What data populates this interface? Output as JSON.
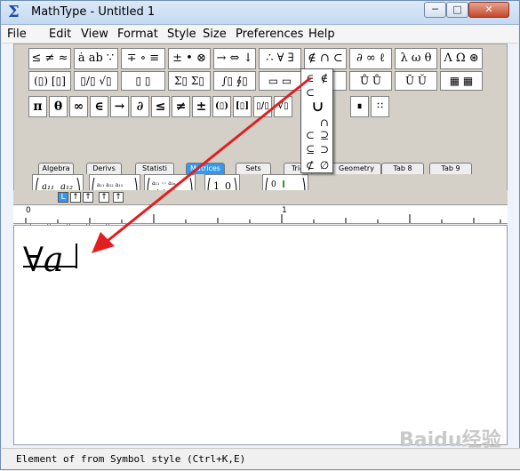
{
  "window": {
    "title": "MathType - Untitled 1",
    "app_icon": "Σ"
  },
  "window_controls": {
    "minimize": "─",
    "maximize": "□",
    "close": "✕"
  },
  "menu": [
    "File",
    "Edit",
    "View",
    "Format",
    "Style",
    "Size",
    "Preferences",
    "Help"
  ],
  "palettes_row1": [
    "≤ ≠ ≈",
    "ȧ ab ∵",
    "∓ ∘ ≡",
    "± • ⊗",
    "→ ⇔ ↓",
    "∴ ∀ ∃",
    "∉ ∩ ⊂",
    "∂ ∞ ℓ",
    "λ ω θ",
    "Λ Ω ⊛"
  ],
  "palettes_row2": [
    "(▯) [▯]",
    "▯/▯ √▯",
    "▯ ▯",
    "Σ▯ Σ▯",
    "∫▯ ∮▯",
    "▭ ▭",
    "",
    "Ů Ů",
    "Ū Ǔ",
    "▦ ▦",
    "▯ ▯"
  ],
  "symbols": [
    "π",
    "θ",
    "∞",
    "∈",
    "→",
    "∂",
    "≤",
    "≠",
    "±",
    "(▯)",
    "[▯]",
    "▯/▯",
    "√▯",
    "∎",
    "∷"
  ],
  "tabs": [
    "Algebra",
    "Derivs",
    "Statisti",
    "Matrices",
    "Sets",
    "Trig",
    "Geometry",
    "Tab 8",
    "Tab 9"
  ],
  "active_tab": "Matrices",
  "templates": [
    "(a11 a12; a21 a22)",
    "3x3 matrix",
    "m x n matrix",
    "(1 0; 0 1)",
    "dotted matrix"
  ],
  "matrix_buttons": [
    "...",
    "⋯",
    "⋮",
    "⋰",
    "⋱"
  ],
  "dropdown_items": [
    "∈",
    "∉",
    "⊂",
    "∪",
    "∩",
    "⊂",
    "⊃",
    "⊆",
    "⊇",
    "⊄",
    "∅"
  ],
  "ruler_buttons": [
    "L",
    "↑",
    "↑",
    "↑",
    "↑"
  ],
  "ruler_labels": [
    "0",
    "1"
  ],
  "formula": "∀a",
  "status": "Element of from Symbol style (Ctrl+K,E)",
  "watermark": "Baidu经验",
  "arrow_color": "#e02020"
}
